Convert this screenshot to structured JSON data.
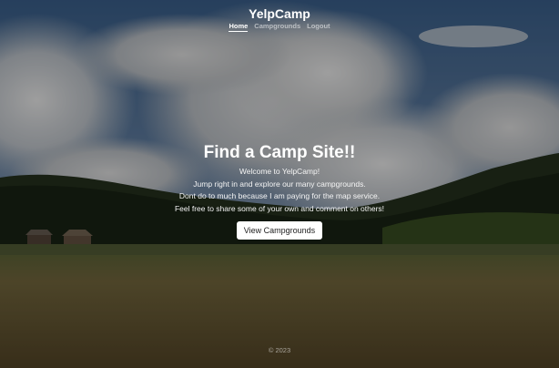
{
  "app": {
    "brand": "YelpCamp"
  },
  "nav": {
    "items": [
      {
        "label": "Home",
        "active": true
      },
      {
        "label": "Campgrounds",
        "active": false
      },
      {
        "label": "Logout",
        "active": false
      }
    ]
  },
  "hero": {
    "title": "Find a Camp Site!!",
    "lines": [
      "Welcome to YelpCamp!",
      "Jump right in and explore our many campgrounds.",
      "Dont do to much because I am paying for the map service.",
      "Feel free to share some of your own and comment on others!"
    ],
    "button_label": "View Campgrounds"
  },
  "footer": {
    "text": "© 2023"
  },
  "colors": {
    "sky": "#5a7da3",
    "cloud": "#c9cdd1",
    "forest": "#1d2a16",
    "field": "#6b5c36",
    "overlay": "rgba(0,0,0,0.38)",
    "button_bg": "#ffffff"
  }
}
